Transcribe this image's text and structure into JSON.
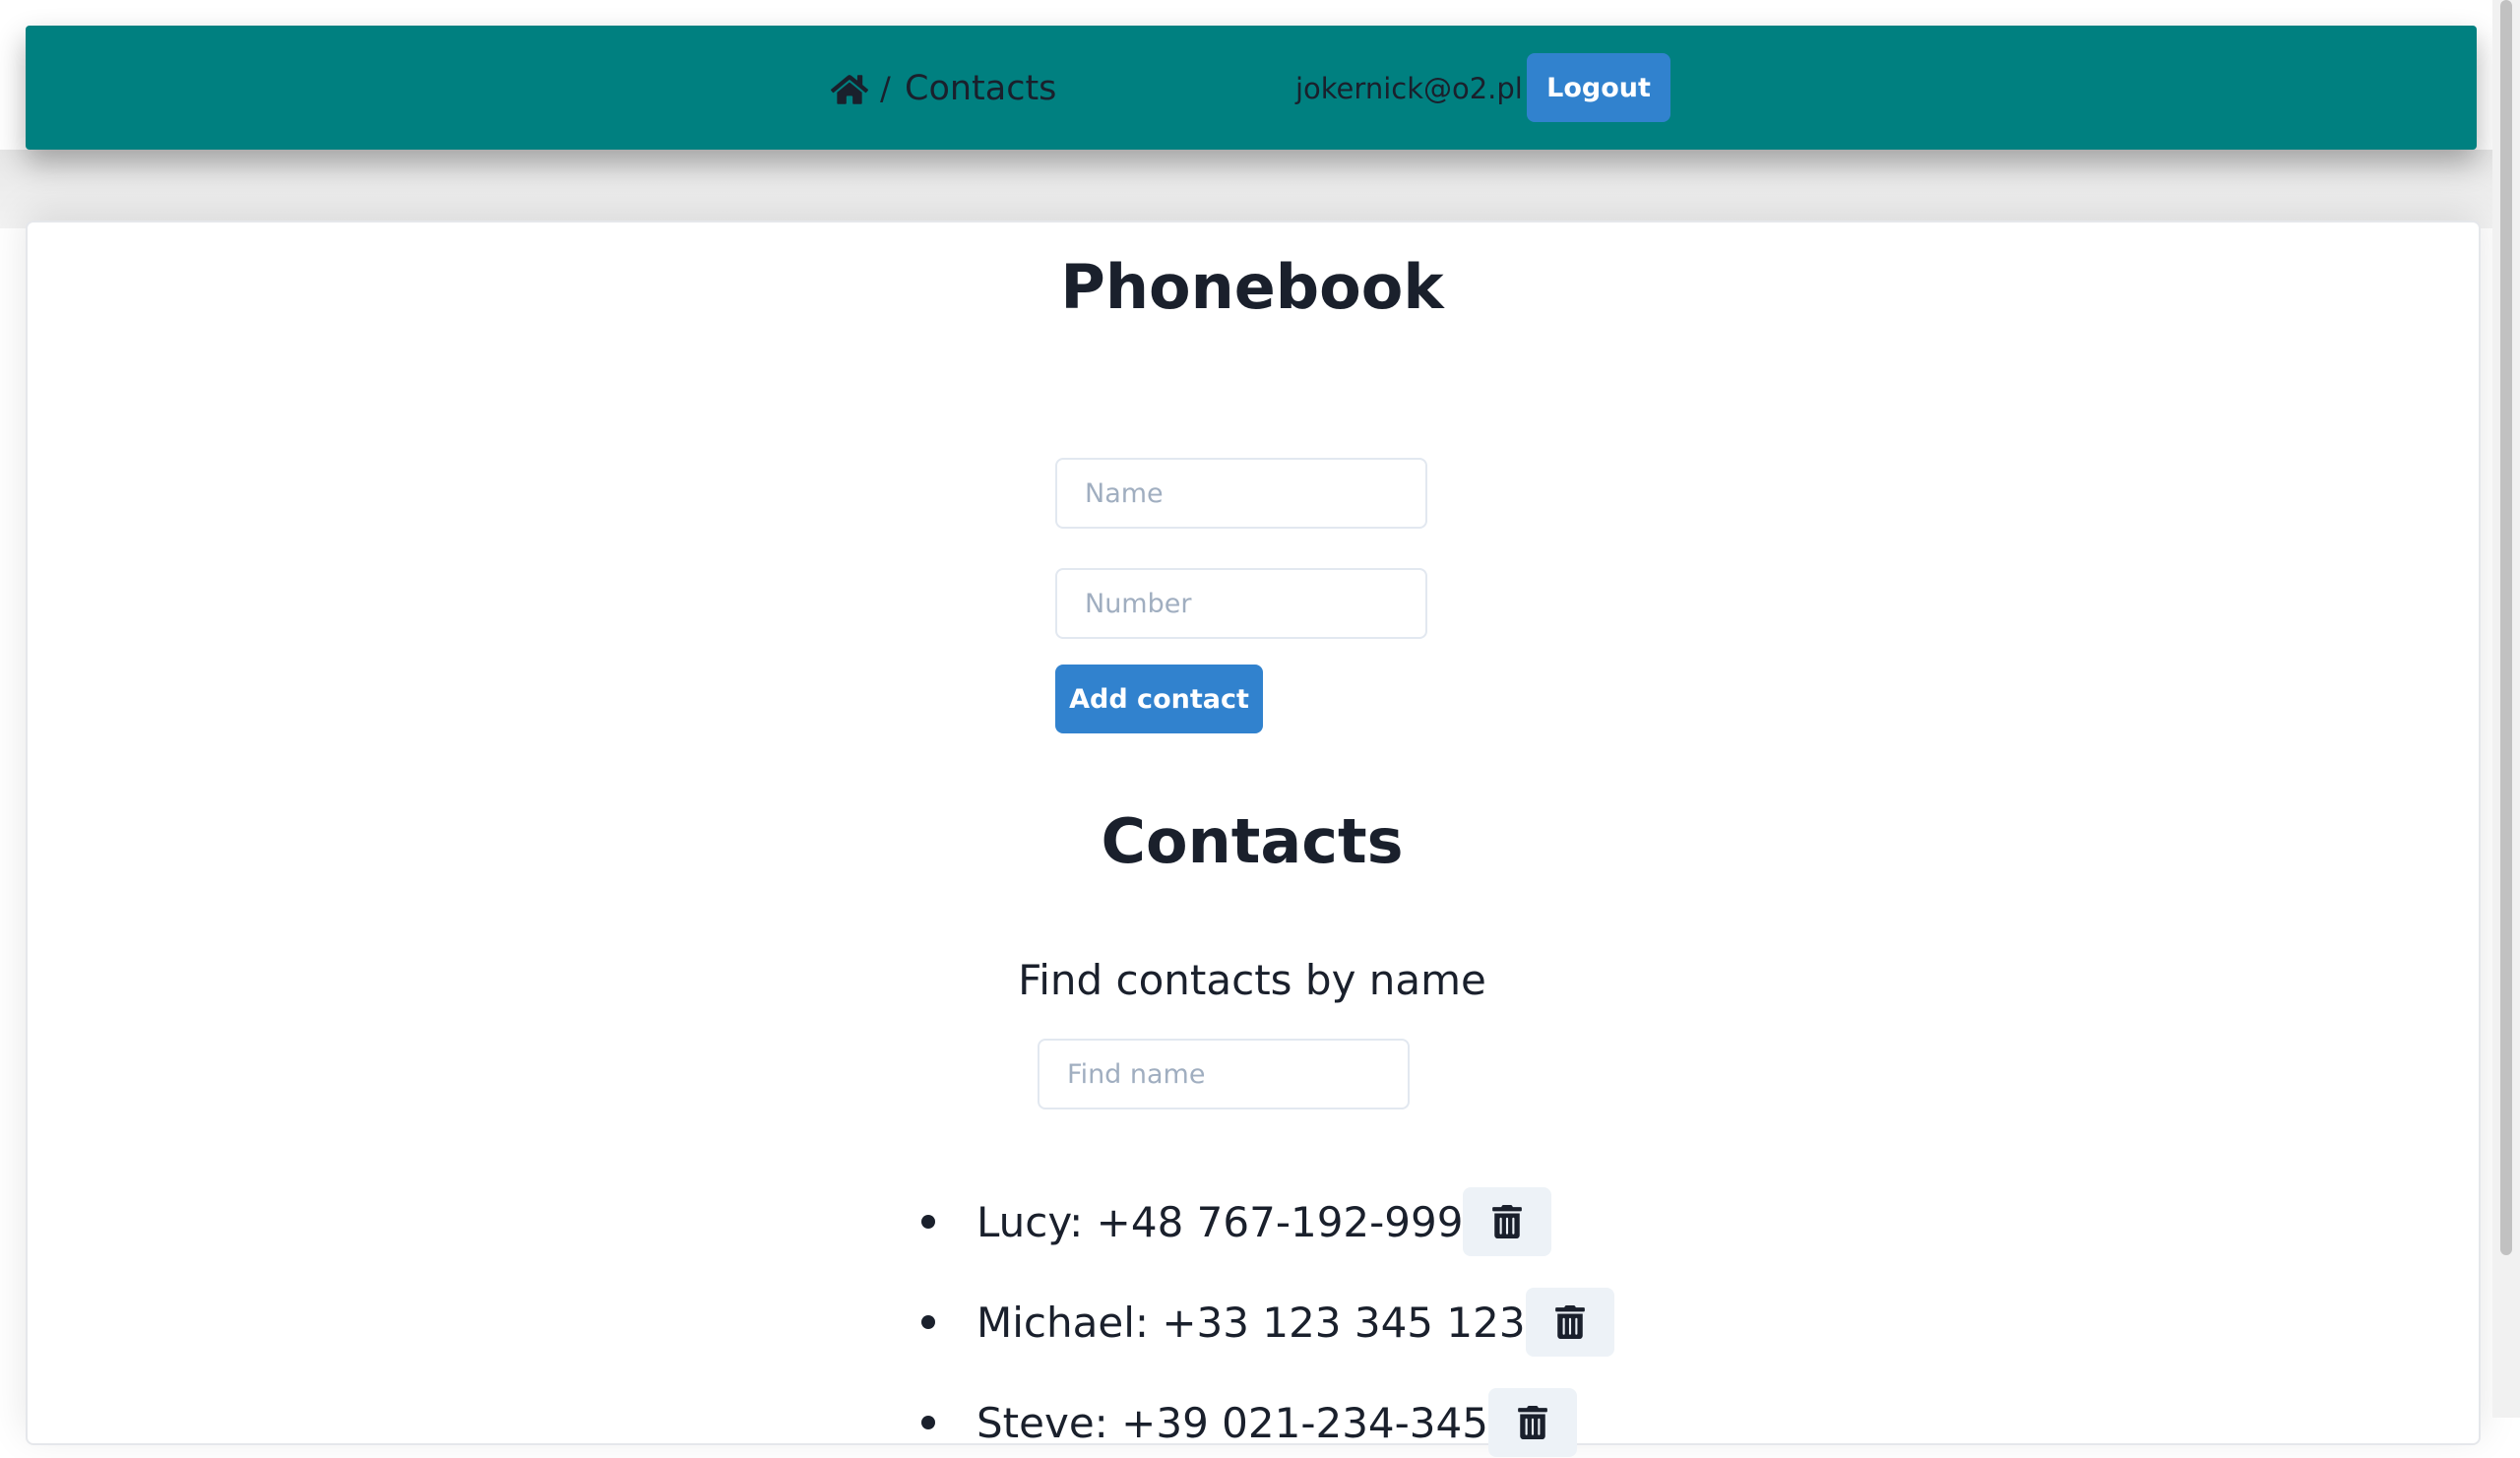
{
  "header": {
    "breadcrumb_separator": "/",
    "breadcrumb_current": "Contacts",
    "home_icon": "home-icon",
    "user_email": "jokernick@o2.pl",
    "logout_label": "Logout",
    "background_color": "#008080",
    "accent_color": "#3182ce"
  },
  "main": {
    "title": "Phonebook",
    "form": {
      "name_placeholder": "Name",
      "name_value": "",
      "number_placeholder": "Number",
      "number_value": "",
      "submit_label": "Add contact"
    },
    "contacts_heading": "Contacts",
    "filter": {
      "label": "Find contacts by name",
      "placeholder": "Find name",
      "value": ""
    },
    "contacts": [
      {
        "name": "Lucy",
        "number": "+48 767-192-999",
        "text": "Lucy: +48 767-192-999",
        "delete_icon": "trash-icon"
      },
      {
        "name": "Michael",
        "number": "+33 123 345 123",
        "text": "Michael: +33 123 345 123",
        "delete_icon": "trash-icon"
      },
      {
        "name": "Steve",
        "number": "+39 021-234-345",
        "text": "Steve: +39 021-234-345",
        "delete_icon": "trash-icon"
      }
    ]
  }
}
